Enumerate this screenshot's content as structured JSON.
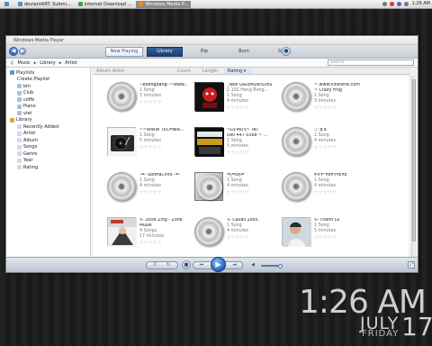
{
  "taskbar": {
    "items": [
      {
        "label": "",
        "active": false
      },
      {
        "label": "deviantART: Submi...",
        "active": false
      },
      {
        "label": "Internet Download ...",
        "active": false
      },
      {
        "label": "Windows Media P...",
        "active": true
      }
    ],
    "clock": "1:26 AM"
  },
  "window": {
    "title": "Windows Media Player",
    "tabs": [
      "Now Playing",
      "Library",
      "Rip",
      "Burn",
      "Sync"
    ],
    "active_tab": "Library",
    "breadcrumb": [
      "Music",
      "Library",
      "Artist"
    ],
    "search_placeholder": "Search"
  },
  "columns": [
    "Album Artist",
    "Count",
    "Length",
    "Rating"
  ],
  "nav": {
    "playlists_label": "Playlists",
    "playlists": [
      "Create Playlist",
      "bm",
      "Club",
      "coffe",
      "Piano",
      "viet"
    ],
    "library_label": "Library",
    "library": [
      "Recently Added",
      "Artist",
      "Album",
      "Songs",
      "Genre",
      "Year",
      "Rating"
    ]
  },
  "tiles": [
    {
      "title": "--boongbang--~www...",
      "count": "1 Song",
      "length": "3 minutes",
      "art": "cd"
    },
    {
      "title": "_sBoi Q&QMusicGrou",
      "count": "1 Song",
      "length": "p 102 Hang Bong...",
      "extra": "1 Song",
      "extra2": "4 minutes",
      "art": "red"
    },
    {
      "title": "~ www.hihihehe.com",
      "count": "~ Crazy Frog",
      "length": "1 Song",
      "extra": "3 minutes",
      "art": "cd"
    },
    {
      "title": "~~WWW TECHNIA...",
      "count": "1 Song",
      "length": "5 minutes",
      "art": "turntable"
    },
    {
      "title": "~Dj-Mu's~ Tel:",
      "count": "090 447 0368 ~ ...",
      "length": "1 Song",
      "extra": "5 minutes",
      "art": "onlyfor"
    },
    {
      "title": "::: q'a",
      "count": "1 Song",
      "length": "4 minutes",
      "art": "cd"
    },
    {
      "title": "-=- SonHai.Info -=-",
      "count": "1 Song",
      "length": "4 minutes",
      "art": "cd"
    },
    {
      "title": "=j=Đ§=",
      "count": "1 Song",
      "length": "4 minutes",
      "art": "case"
    },
    {
      "title": "¥×¥°¥é¥Ý¥Ê¥Ê",
      "count": "1 Song",
      "length": "4 minutes",
      "art": "cd"
    },
    {
      "title": "© 2008 Zing - Zone",
      "count": "Musik",
      "length": "4 Songs",
      "extra": "17 minutes",
      "art": "kat"
    },
    {
      "title": "© Cavali 2oo5.",
      "count": "1 Song",
      "length": "4 minutes",
      "art": "cd"
    },
    {
      "title": "© Thành Lu",
      "count": "1 Song",
      "length": "5 minutes",
      "art": "photo"
    }
  ],
  "clock": {
    "time": "1:26 AM",
    "month": "JULY",
    "day": "17",
    "weekday": "FRIDAY"
  }
}
